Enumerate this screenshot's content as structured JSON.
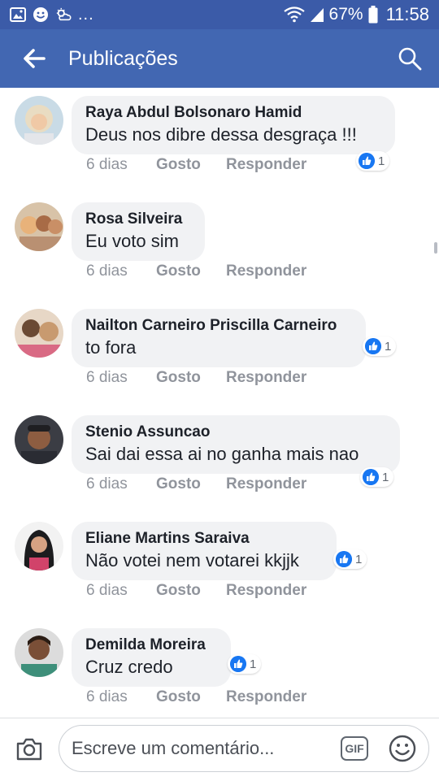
{
  "status_bar": {
    "battery": "67%",
    "time": "11:58",
    "overflow": "..."
  },
  "app_bar": {
    "title": "Publicações",
    "back_icon": "arrow-left-icon",
    "search_icon": "search-icon"
  },
  "comments": [
    {
      "author": "Raya Abdul Bolsonaro Hamid",
      "text": "Deus nos dibre dessa desgraça !!!",
      "time": "6 dias",
      "like_label": "Gosto",
      "reply_label": "Responder",
      "reactions": "1"
    },
    {
      "author": "Rosa Silveira",
      "text": "Eu voto sim",
      "time": "6 dias",
      "like_label": "Gosto",
      "reply_label": "Responder"
    },
    {
      "author": "Nailton Carneiro Priscilla Carneiro",
      "text": "to fora",
      "time": "6 dias",
      "like_label": "Gosto",
      "reply_label": "Responder",
      "reactions": "1"
    },
    {
      "author": "Stenio Assuncao",
      "text": "Sai dai essa ai no ganha mais nao",
      "time": "6 dias",
      "like_label": "Gosto",
      "reply_label": "Responder",
      "reactions": "1"
    },
    {
      "author": "Eliane Martins Saraiva",
      "text": "Não votei nem votarei kkjjk",
      "time": "6 dias",
      "like_label": "Gosto",
      "reply_label": "Responder",
      "reactions": "1"
    },
    {
      "author": "Demilda Moreira",
      "text": "Cruz credo",
      "time": "6 dias",
      "like_label": "Gosto",
      "reply_label": "Responder",
      "reactions": "1"
    }
  ],
  "composer": {
    "placeholder": "Escreve um comentário...",
    "gif_label": "GIF",
    "camera_icon": "camera-icon",
    "emoji_icon": "emoji-icon"
  },
  "colors": {
    "status_bar": "#3b5ba8",
    "app_bar": "#4267b2",
    "bubble": "#f1f2f4",
    "like_blue": "#1877f2",
    "meta_gray": "#90949c"
  }
}
